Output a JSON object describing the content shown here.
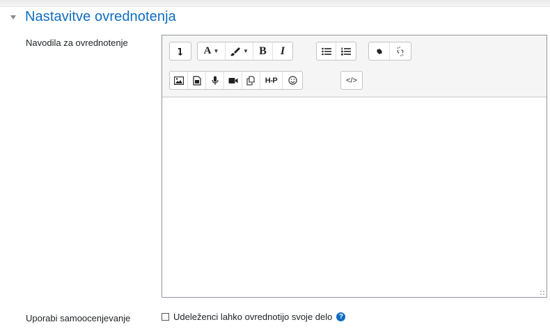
{
  "section": {
    "title": "Nastavitve ovrednotenja",
    "collapse_icon": "chevron-down-icon"
  },
  "fields": {
    "instructions_label": "Navodila za ovrednotenje",
    "self_assessment_label": "Uporabi samoocenjevanje",
    "self_assessment_checkbox_label": "Udeleženci lahko ovrednotijo svoje delo",
    "self_assessment_checked": false,
    "help_glyph": "?"
  },
  "editor": {
    "content": "",
    "toolbar_row1": [
      {
        "name": "show-more-buttons-icon",
        "glyph": "↴"
      },
      {
        "name": "font-color-icon",
        "label": "A"
      },
      {
        "name": "highlight-brush-icon"
      },
      {
        "name": "bold-icon",
        "label": "B"
      },
      {
        "name": "italic-icon",
        "label": "I"
      },
      {
        "name": "unordered-list-icon"
      },
      {
        "name": "ordered-list-icon"
      },
      {
        "name": "link-icon"
      },
      {
        "name": "unlink-icon"
      }
    ],
    "toolbar_row2": [
      {
        "name": "image-icon"
      },
      {
        "name": "media-icon"
      },
      {
        "name": "record-audio-icon"
      },
      {
        "name": "record-video-icon"
      },
      {
        "name": "manage-files-icon"
      },
      {
        "name": "h5p-icon",
        "label": "H-P"
      },
      {
        "name": "emoji-icon"
      },
      {
        "name": "html-source-icon",
        "label": "</>"
      }
    ]
  }
}
